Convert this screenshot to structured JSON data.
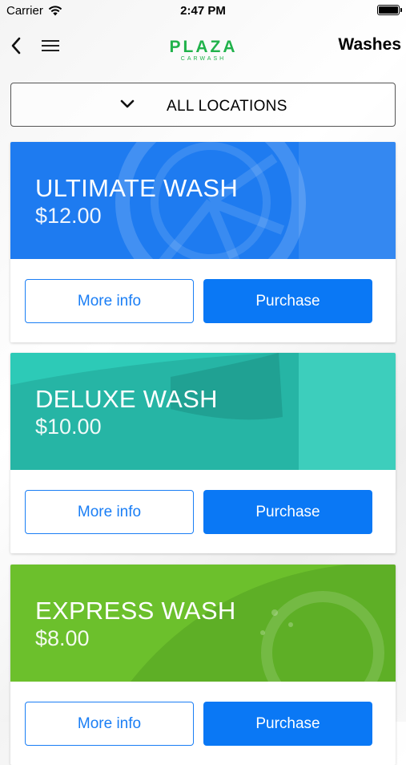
{
  "status_bar": {
    "carrier": "Carrier",
    "time": "2:47 PM"
  },
  "nav": {
    "title": "Washes",
    "logo_top": "PLAZA",
    "logo_bottom": "CARWASH"
  },
  "location_selector": {
    "label": "ALL LOCATIONS"
  },
  "washes": [
    {
      "name": "ULTIMATE WASH",
      "price": "$12.00",
      "more_info_label": "More info",
      "purchase_label": "Purchase",
      "color": "#1e7bf0"
    },
    {
      "name": "DELUXE WASH",
      "price": "$10.00",
      "more_info_label": "More info",
      "purchase_label": "Purchase",
      "color": "#2dcab7"
    },
    {
      "name": "EXPRESS WASH",
      "price": "$8.00",
      "more_info_label": "More info",
      "purchase_label": "Purchase",
      "color": "#6cc02c"
    }
  ],
  "colors": {
    "accent": "#0a78f5",
    "logo": "#21b24b"
  }
}
